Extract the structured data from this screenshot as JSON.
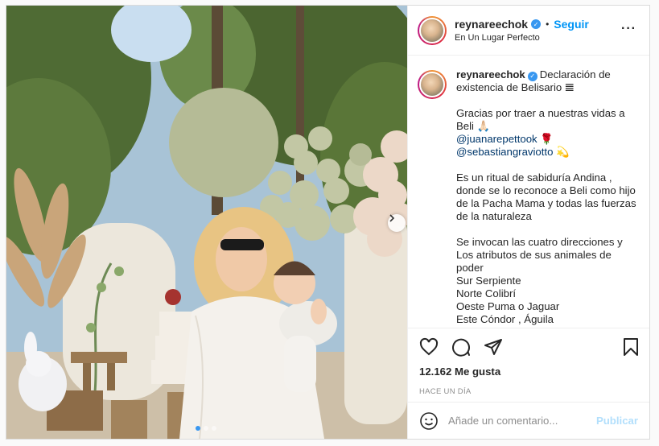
{
  "header": {
    "username": "reynareechok",
    "separator": "•",
    "follow_label": "Seguir",
    "location": "En Un Lugar Perfecto",
    "more_icon": "more-horizontal-icon"
  },
  "caption": {
    "username": "reynareechok",
    "lines": {
      "p1": "Declaración de existencia de Belisario 𝌆",
      "p2a": "Gracias por traer a nuestras vidas a Beli 🙏🏻",
      "mention1": "@juanarepettook",
      "mention1_emoji": " 🌹",
      "mention2": "@sebastiangraviotto",
      "mention2_emoji": " 💫",
      "p3": "Es un ritual de sabiduría Andina , donde se lo reconoce a Beli como hijo de la Pacha Mama y todas las fuerzas de la naturaleza",
      "p4": "Se invocan las cuatro direcciones y Los atributos de sus animales de poder\nSur Serpiente\nNorte Colibrí\nOeste Puma o Jaguar\nEste Cóndor , Águila"
    }
  },
  "actions": {
    "like_icon": "heart-icon",
    "comment_icon": "comment-icon",
    "share_icon": "paper-plane-icon",
    "save_icon": "bookmark-icon",
    "likes_text": "12.162 Me gusta",
    "time_text": "HACE UN DÍA"
  },
  "comment": {
    "emoji_icon": "smiley-icon",
    "placeholder": "Añade un comentario...",
    "publish_label": "Publicar"
  },
  "media": {
    "carousel_dots": 3,
    "active_dot": 0
  },
  "colors": {
    "accent": "#0095f6",
    "publish_disabled": "#b2dffc",
    "verified": "#3897f0"
  }
}
